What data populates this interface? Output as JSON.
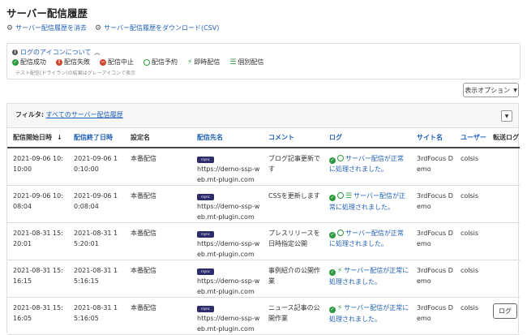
{
  "page": {
    "title": "サーバー配信履歴"
  },
  "actions": {
    "clear": "サーバー配信履歴を消去",
    "download": "サーバー配信履歴をダウンロード(CSV)"
  },
  "legend": {
    "heading": "ログのアイコンについて",
    "items": [
      "配信成功",
      "配信失敗",
      "配信中止",
      "配信予約",
      "即時配信",
      "個別配信"
    ],
    "note": "テスト配信(ドライラン)の結果はグレーアイコンで表示"
  },
  "display_options": {
    "label": "表示オプション"
  },
  "filter": {
    "label": "フィルタ:",
    "value": "すべてのサーバー配信履歴"
  },
  "table": {
    "headers": {
      "start": "配信開始日時",
      "end": "配信終了日時",
      "setting": "設定名",
      "dest": "配信先名",
      "comment": "コメント",
      "log": "ログ",
      "site": "サイト名",
      "user": "ユーザー",
      "transfer": "転送ログ"
    },
    "sort_indicator": "↓",
    "badge_text": "rsync",
    "rows": [
      {
        "start": "2021-09-06 10:10:00",
        "end": "2021-09-06 10:10:00",
        "setting": "本番配信",
        "dest": "https://demo-ssp-web.mt-plugin.com",
        "comment": "ブログ記事更新です",
        "log_type": "scheduled",
        "log": "サーバー配信が正常に処理されました。",
        "site": "3rdFocus Demo",
        "user": "colsis",
        "transfer": ""
      },
      {
        "start": "2021-09-06 10:08:04",
        "end": "2021-09-06 10:08:04",
        "setting": "本番配信",
        "dest": "https://demo-ssp-web.mt-plugin.com",
        "comment": "CSSを更新します",
        "log_type": "scheduled-individual",
        "log": "サーバー配信が正常に処理されました。",
        "site": "3rdFocus Demo",
        "user": "colsis",
        "transfer": ""
      },
      {
        "start": "2021-08-31 15:20:01",
        "end": "2021-08-31 15:20:01",
        "setting": "本番配信",
        "dest": "https://demo-ssp-web.mt-plugin.com",
        "comment": "プレスリリースを日時指定公開",
        "log_type": "scheduled",
        "log": "サーバー配信が正常に処理されました。",
        "site": "3rdFocus Demo",
        "user": "colsis",
        "transfer": ""
      },
      {
        "start": "2021-08-31 15:16:15",
        "end": "2021-08-31 15:16:15",
        "setting": "本番配信",
        "dest": "https://demo-ssp-web.mt-plugin.com",
        "comment": "事例紹介の公開作業",
        "log_type": "instant",
        "log": "サーバー配信が正常に処理されました。",
        "site": "3rdFocus Demo",
        "user": "colsis",
        "transfer": ""
      },
      {
        "start": "2021-08-31 15:16:05",
        "end": "2021-08-31 15:16:05",
        "setting": "本番配信",
        "dest": "https://demo-ssp-web.mt-plugin.com",
        "comment": "ニュース記事の公開作業",
        "log_type": "instant",
        "log": "サーバー配信が正常に処理されました。",
        "site": "3rdFocus Demo",
        "user": "colsis",
        "transfer": "ログ"
      }
    ]
  },
  "colors": {
    "link": "#1f5fb8",
    "success": "#2e9a3e",
    "error": "#d2462f",
    "badge": "#2d2b6b"
  }
}
